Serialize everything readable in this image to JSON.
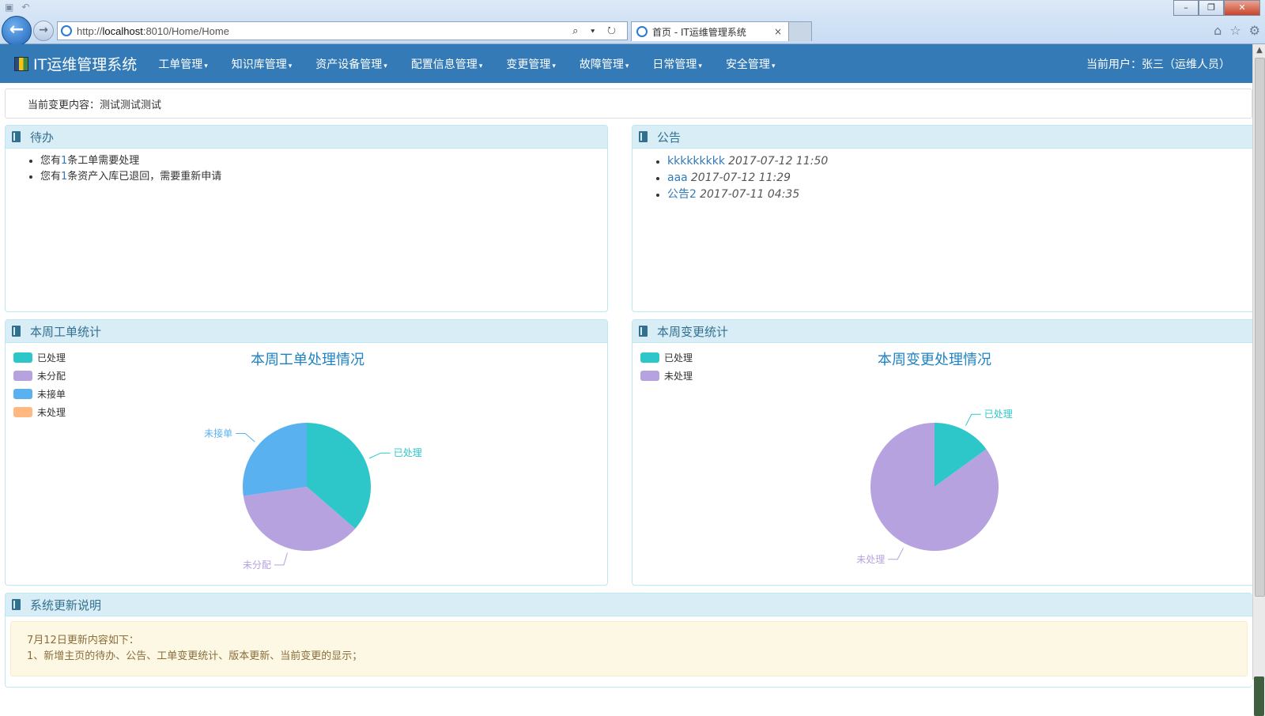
{
  "browser": {
    "url_prefix": "http://",
    "url_host": "localhost",
    "url_rest": ":8010/Home/Home",
    "tab_title": "首页 - IT运维管理系统",
    "tab_close": "×",
    "back_glyph": "←",
    "forward_glyph": "→",
    "search_tools": "⌕ ▾ ↻",
    "home_icon": "home-icon",
    "star_icon": "star-icon",
    "gear_icon": "gear-icon"
  },
  "app": {
    "brand": "IT运维管理系统",
    "menu": [
      {
        "label": "工单管理"
      },
      {
        "label": "知识库管理"
      },
      {
        "label": "资产设备管理"
      },
      {
        "label": "配置信息管理"
      },
      {
        "label": "变更管理"
      },
      {
        "label": "故障管理"
      },
      {
        "label": "日常管理"
      },
      {
        "label": "安全管理"
      }
    ],
    "caret": "▾",
    "user": "当前用户：张三（运维人员）",
    "brand_color": "#337ab7"
  },
  "current_change": {
    "text": "当前变更内容：测试测试测试"
  },
  "todo": {
    "title": "待办",
    "items": [
      {
        "pre": "您有",
        "num": "1",
        "post": "条工单需要处理"
      },
      {
        "pre": "您有",
        "num": "1",
        "post": "条资产入库已退回，需要重新申请"
      }
    ]
  },
  "notice": {
    "title": "公告",
    "items": [
      {
        "title": "kkkkkkkkk",
        "time": "2017-07-12 11:50"
      },
      {
        "title": "aaa",
        "time": "2017-07-12 11:29"
      },
      {
        "title": "公告2",
        "time": "2017-07-11 04:35"
      }
    ]
  },
  "ticket_stats": {
    "title": "本周工单统计"
  },
  "change_stats": {
    "title": "本周变更统计"
  },
  "chart_data": [
    {
      "type": "pie",
      "title": "本周工单处理情况",
      "legend": [
        "已处理",
        "未分配",
        "未接单",
        "未处理"
      ],
      "categories": [
        "已处理",
        "未分配",
        "未接单",
        "未处理"
      ],
      "values": [
        1,
        1,
        0.75,
        0
      ],
      "colors": [
        "#2ec7c9",
        "#b6a2de",
        "#5ab1ef",
        "#ffb980"
      ],
      "legend_position": "top-left"
    },
    {
      "type": "pie",
      "title": "本周变更处理情况",
      "legend": [
        "已处理",
        "未处理"
      ],
      "categories": [
        "已处理",
        "未处理"
      ],
      "values": [
        0.15,
        0.85
      ],
      "colors": [
        "#2ec7c9",
        "#b6a2de"
      ],
      "legend_position": "top-left"
    }
  ],
  "update_notes": {
    "title": "系统更新说明",
    "lines": [
      "7月12日更新内容如下：",
      "1、新增主页的待办、公告、工单变更统计、版本更新、当前变更的显示；"
    ]
  }
}
